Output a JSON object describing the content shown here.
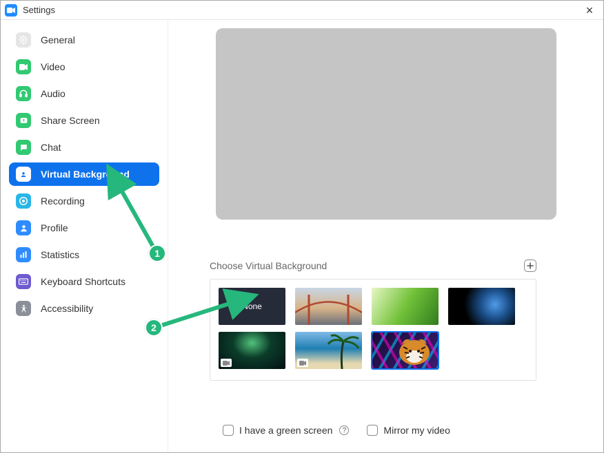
{
  "window": {
    "title": "Settings"
  },
  "sidebar": {
    "items": [
      {
        "id": "general",
        "label": "General"
      },
      {
        "id": "video",
        "label": "Video"
      },
      {
        "id": "audio",
        "label": "Audio"
      },
      {
        "id": "share-screen",
        "label": "Share Screen"
      },
      {
        "id": "chat",
        "label": "Chat"
      },
      {
        "id": "virtual-background",
        "label": "Virtual Background"
      },
      {
        "id": "recording",
        "label": "Recording"
      },
      {
        "id": "profile",
        "label": "Profile"
      },
      {
        "id": "statistics",
        "label": "Statistics"
      },
      {
        "id": "keyboard-shortcuts",
        "label": "Keyboard Shortcuts"
      },
      {
        "id": "accessibility",
        "label": "Accessibility"
      }
    ],
    "active_index": 5
  },
  "main": {
    "choose_label": "Choose Virtual Background",
    "thumbs": [
      {
        "id": "none",
        "label": "None",
        "has_video_badge": false
      },
      {
        "id": "bridge",
        "label": "",
        "has_video_badge": false
      },
      {
        "id": "grass",
        "label": "",
        "has_video_badge": false
      },
      {
        "id": "earth",
        "label": "",
        "has_video_badge": false
      },
      {
        "id": "aurora",
        "label": "",
        "has_video_badge": true
      },
      {
        "id": "beach",
        "label": "",
        "has_video_badge": true
      },
      {
        "id": "tiger",
        "label": "",
        "has_video_badge": false
      }
    ],
    "selected_thumb_index": 6,
    "check_green_screen": "I have a green screen",
    "check_mirror": "Mirror my video"
  },
  "annotations": [
    {
      "num": "1"
    },
    {
      "num": "2"
    }
  ]
}
